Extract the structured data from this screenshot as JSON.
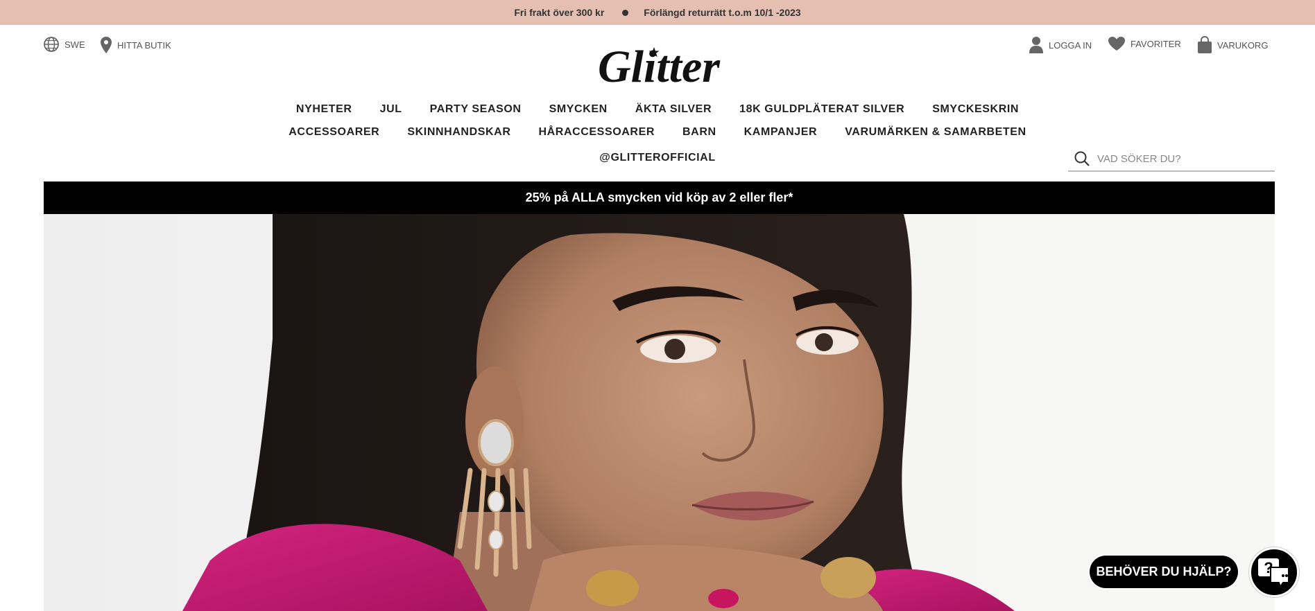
{
  "announcement": {
    "left": "Fri frakt över 300 kr",
    "right": "Förlängd returrätt t.o.m 10/1 -2023"
  },
  "header": {
    "region_label": "SWE",
    "store_label": "HITTA BUTIK",
    "logo_text": "Glitter",
    "login_label": "LOGGA IN",
    "favorites_label": "FAVORITER",
    "cart_label": "VARUKORG"
  },
  "nav": {
    "row1": [
      "NYHETER",
      "JUL",
      "PARTY SEASON",
      "SMYCKEN",
      "ÄKTA SILVER",
      "18K GULDPLÄTERAT SILVER",
      "SMYCKESKRIN"
    ],
    "row2": [
      "ACCESSOARER",
      "SKINNHANDSKAR",
      "HÅRACCESSOARER",
      "BARN",
      "KAMPANJER",
      "VARUMÄRKEN & SAMARBETEN"
    ],
    "row3": [
      "@GLITTEROFFICIAL"
    ]
  },
  "search": {
    "placeholder": "VAD SÖKER DU?"
  },
  "promo": {
    "text": "25% på ALLA smycken vid köp av 2 eller fler*"
  },
  "help": {
    "button_label": "BEHÖVER DU HJÄLP?"
  },
  "colors": {
    "announcement_bg": "#e5c0b2",
    "promo_bg": "#000000",
    "hero_top": "#c2156f"
  }
}
